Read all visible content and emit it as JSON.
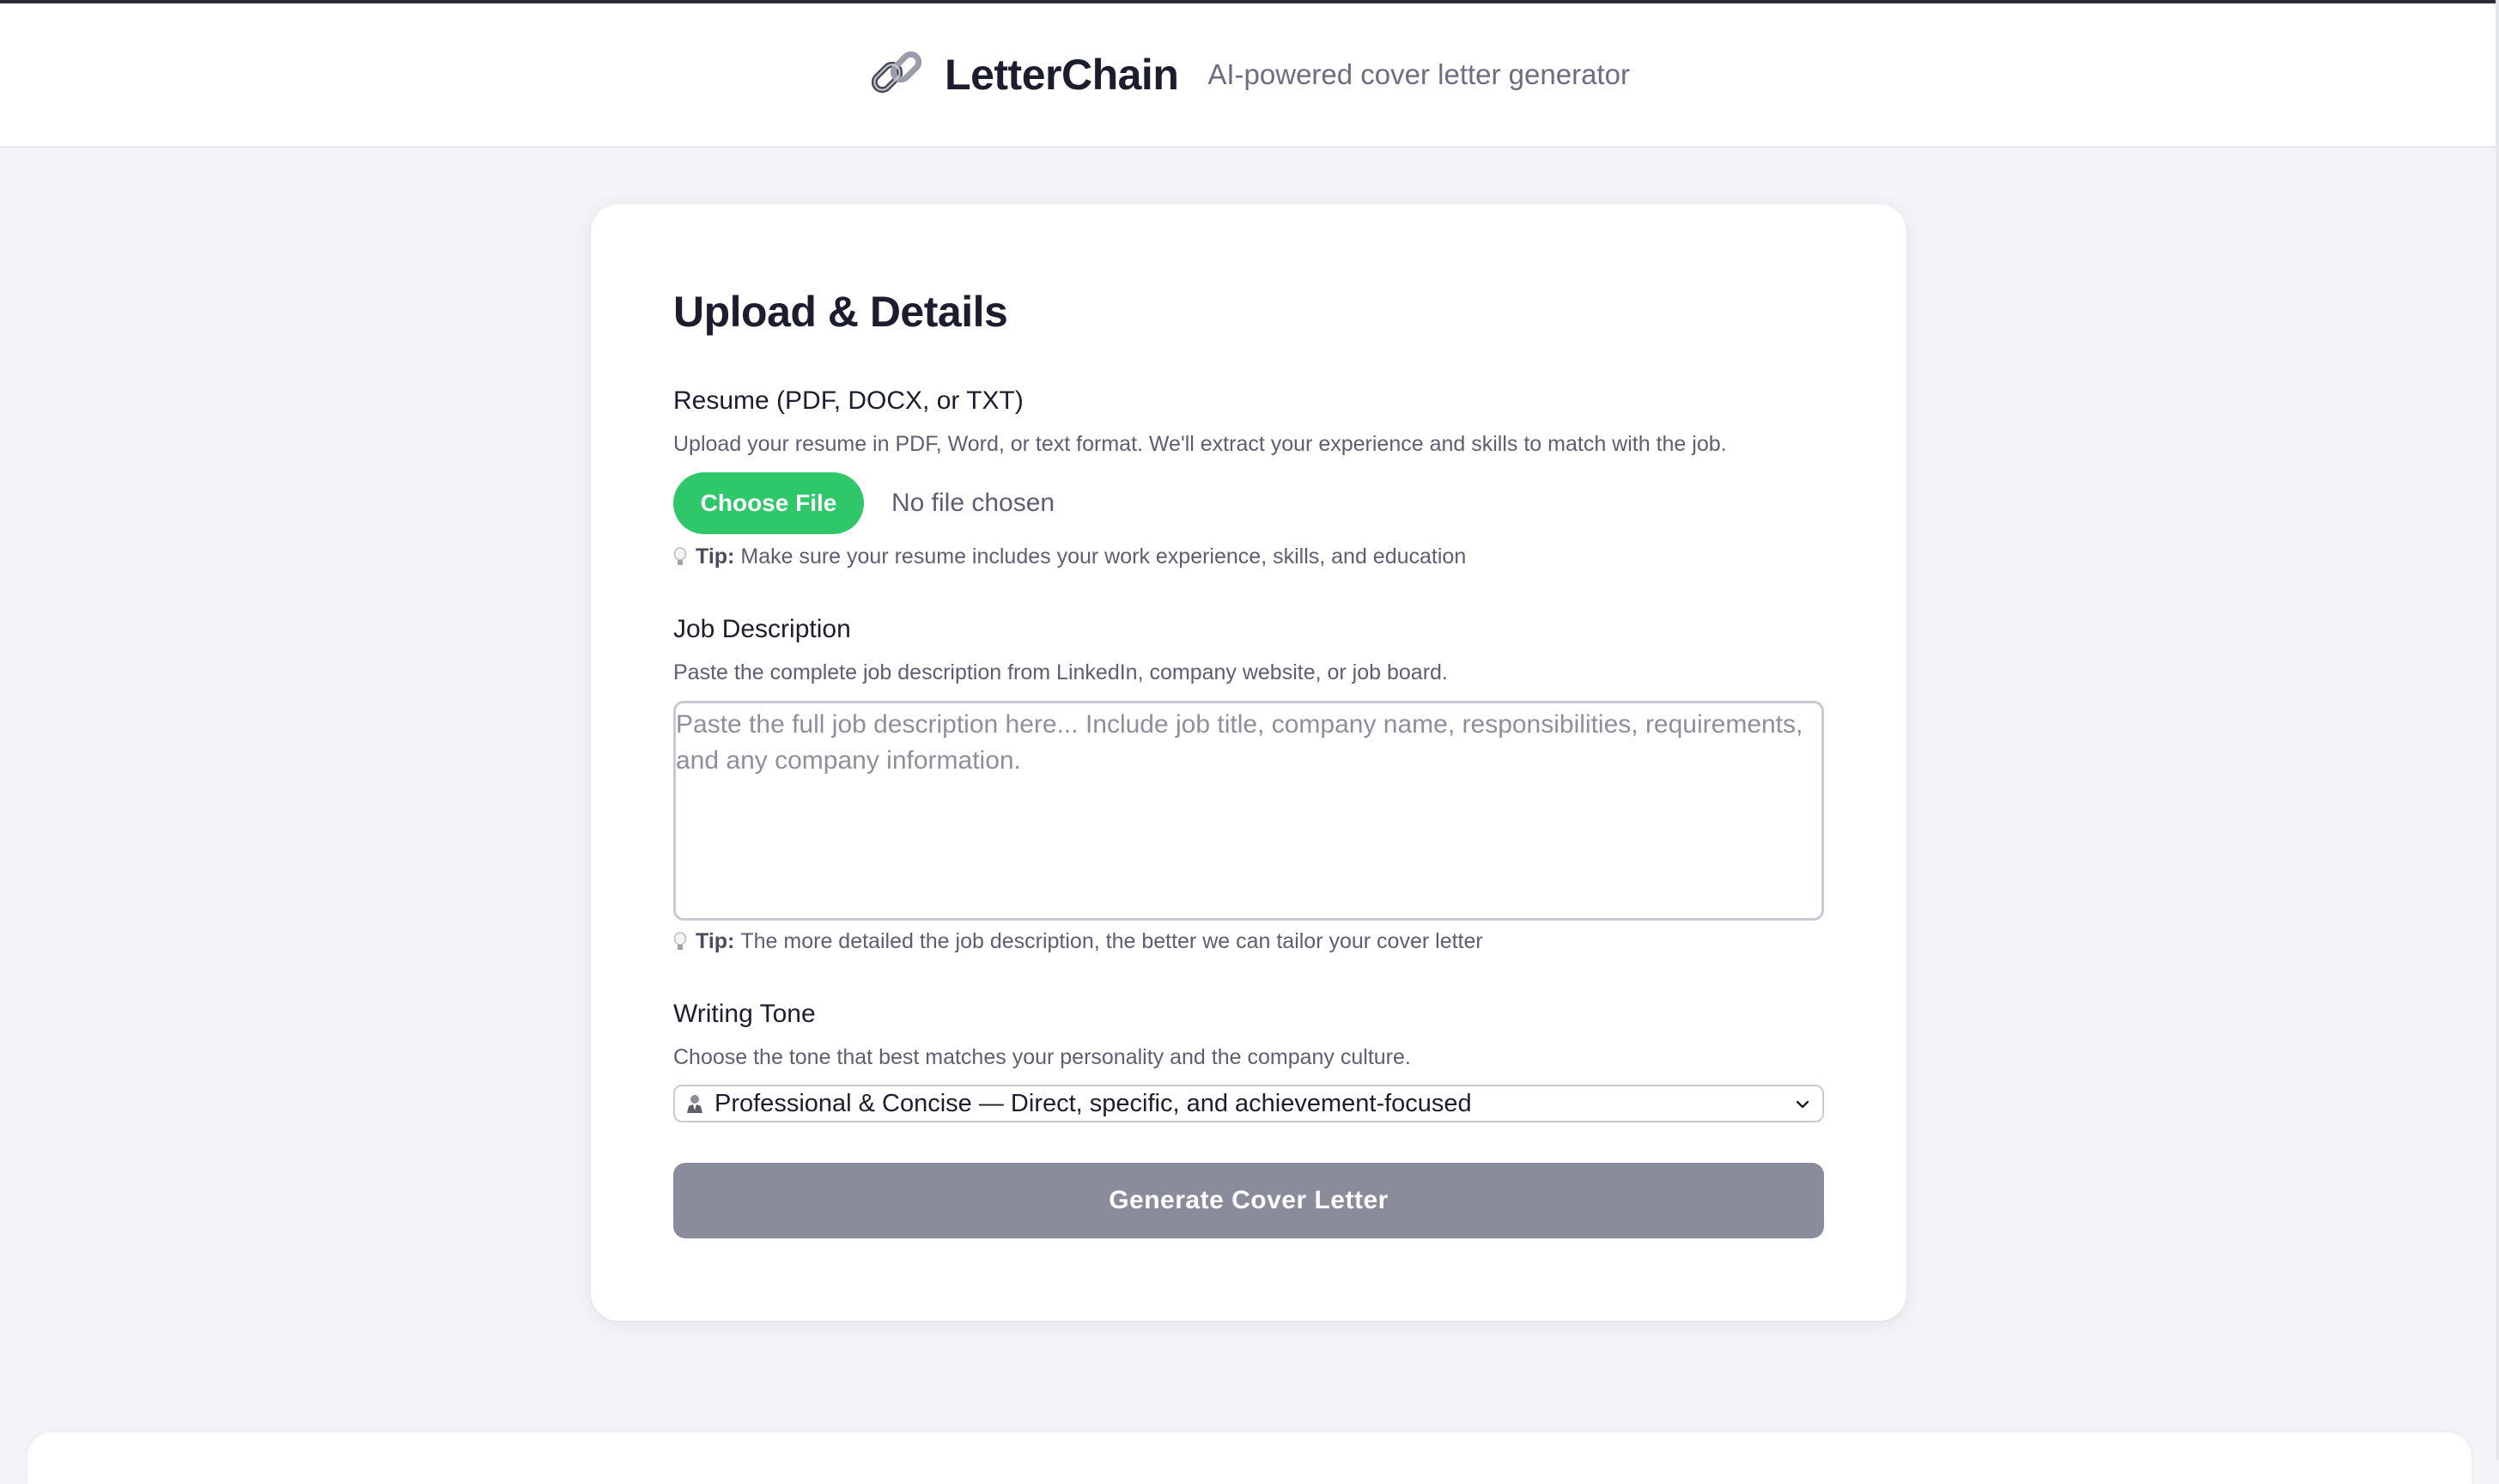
{
  "header": {
    "logo_icon": "link-chain-icon",
    "brand_name": "LetterChain",
    "tagline": "AI-powered cover letter generator"
  },
  "form": {
    "title": "Upload & Details",
    "resume": {
      "label": "Resume (PDF, DOCX, or TXT)",
      "help": "Upload your resume in PDF, Word, or text format. We'll extract your experience and skills to match with the job.",
      "button_label": "Choose File",
      "file_status": "No file chosen",
      "tip_label": "Tip:",
      "tip_text": "Make sure your resume includes your work experience, skills, and education"
    },
    "job": {
      "label": "Job Description",
      "help": "Paste the complete job description from LinkedIn, company website, or job board.",
      "placeholder": "Paste the full job description here... Include job title, company name, responsibilities, requirements, and any company information.",
      "value": "",
      "tip_label": "Tip:",
      "tip_text": "The more detailed the job description, the better we can tailor your cover letter"
    },
    "tone": {
      "label": "Writing Tone",
      "help": "Choose the tone that best matches your personality and the company culture.",
      "selected_icon": "person-in-suit-icon",
      "selected": "Professional & Concise — Direct, specific, and achievement-focused"
    },
    "submit_label": "Generate Cover Letter"
  },
  "colors": {
    "accent_green": "#2ec86a",
    "button_disabled": "#8b8c9b",
    "background": "#f3f4f7"
  }
}
